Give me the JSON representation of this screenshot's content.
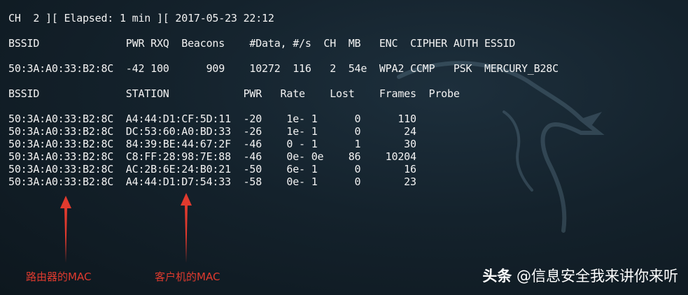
{
  "terminal": {
    "status_line": "CH  2 ][ Elapsed: 1 min ][ 2017-05-23 22:12",
    "ap_header": "BSSID              PWR RXQ  Beacons    #Data, #/s  CH  MB   ENC  CIPHER AUTH ESSID",
    "ap_rows": [
      "50:3A:A0:33:B2:8C  -42 100      909    10272  116   2  54e  WPA2 CCMP   PSK  MERCURY_B28C"
    ],
    "station_header": "BSSID              STATION            PWR   Rate    Lost    Frames  Probe",
    "station_rows": [
      "50:3A:A0:33:B2:8C  A4:44:D1:CF:5D:11  -20    1e- 1      0      110",
      "50:3A:A0:33:B2:8C  DC:53:60:A0:BD:33  -26    1e- 1      0       24",
      "50:3A:A0:33:B2:8C  84:39:BE:44:67:2F  -46    0 - 1      1       30",
      "50:3A:A0:33:B2:8C  C8:FF:28:98:7E:88  -46    0e- 0e    86    10204",
      "50:3A:A0:33:B2:8C  AC:2B:6E:24:B0:21  -50    6e- 1      0       16",
      "50:3A:A0:33:B2:8C  A4:44:D1:D7:54:33  -58    0e- 1      0       23"
    ]
  },
  "annotations": {
    "router_label": "路由器的MAC",
    "client_label": "客户机的MAC",
    "color": "#e03a2e"
  },
  "watermark": {
    "brand": "头条",
    "handle": "@信息安全我来讲你来听"
  },
  "background": {
    "color": "#14222c",
    "logo": "kali-dragon-icon"
  }
}
